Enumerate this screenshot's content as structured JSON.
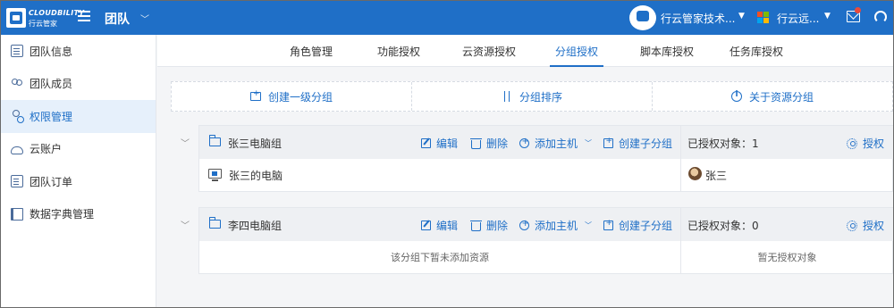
{
  "brand": {
    "name": "CLOUDBILITY",
    "sub": "行云管家"
  },
  "header": {
    "title": "团队",
    "org_name": "行云管家技术...",
    "ms_name": "行云远..."
  },
  "sidebar": {
    "items": [
      {
        "label": "团队信息",
        "icon": "doc-icon",
        "active": false
      },
      {
        "label": "团队成员",
        "icon": "users-icon",
        "active": false
      },
      {
        "label": "权限管理",
        "icon": "permission-icon",
        "active": true
      },
      {
        "label": "云账户",
        "icon": "cloud-icon",
        "active": false
      },
      {
        "label": "团队订单",
        "icon": "order-icon",
        "active": false
      },
      {
        "label": "数据字典管理",
        "icon": "book-icon",
        "active": false
      }
    ]
  },
  "tabs": [
    {
      "label": "角色管理",
      "active": false
    },
    {
      "label": "功能授权",
      "active": false
    },
    {
      "label": "云资源授权",
      "active": false
    },
    {
      "label": "分组授权",
      "active": true
    },
    {
      "label": "脚本库授权",
      "active": false
    },
    {
      "label": "任务库授权",
      "active": false
    }
  ],
  "actions": {
    "create": "创建一级分组",
    "sort": "分组排序",
    "about": "关于资源分组"
  },
  "group_ops": {
    "edit": "编辑",
    "delete": "删除",
    "add_host": "添加主机",
    "create_sub": "创建子分组",
    "authorize": "授权"
  },
  "groups": [
    {
      "name": "张三电脑组",
      "auth_label": "已授权对象：1",
      "resource": "张三的电脑",
      "user": "张三"
    },
    {
      "name": "李四电脑组",
      "auth_label": "已授权对象：0",
      "empty_resource": "该分组下暂未添加资源",
      "empty_auth": "暂无授权对象"
    }
  ],
  "colors": {
    "brand": "#1f6fc7",
    "active_bg": "#e6f0fb"
  }
}
